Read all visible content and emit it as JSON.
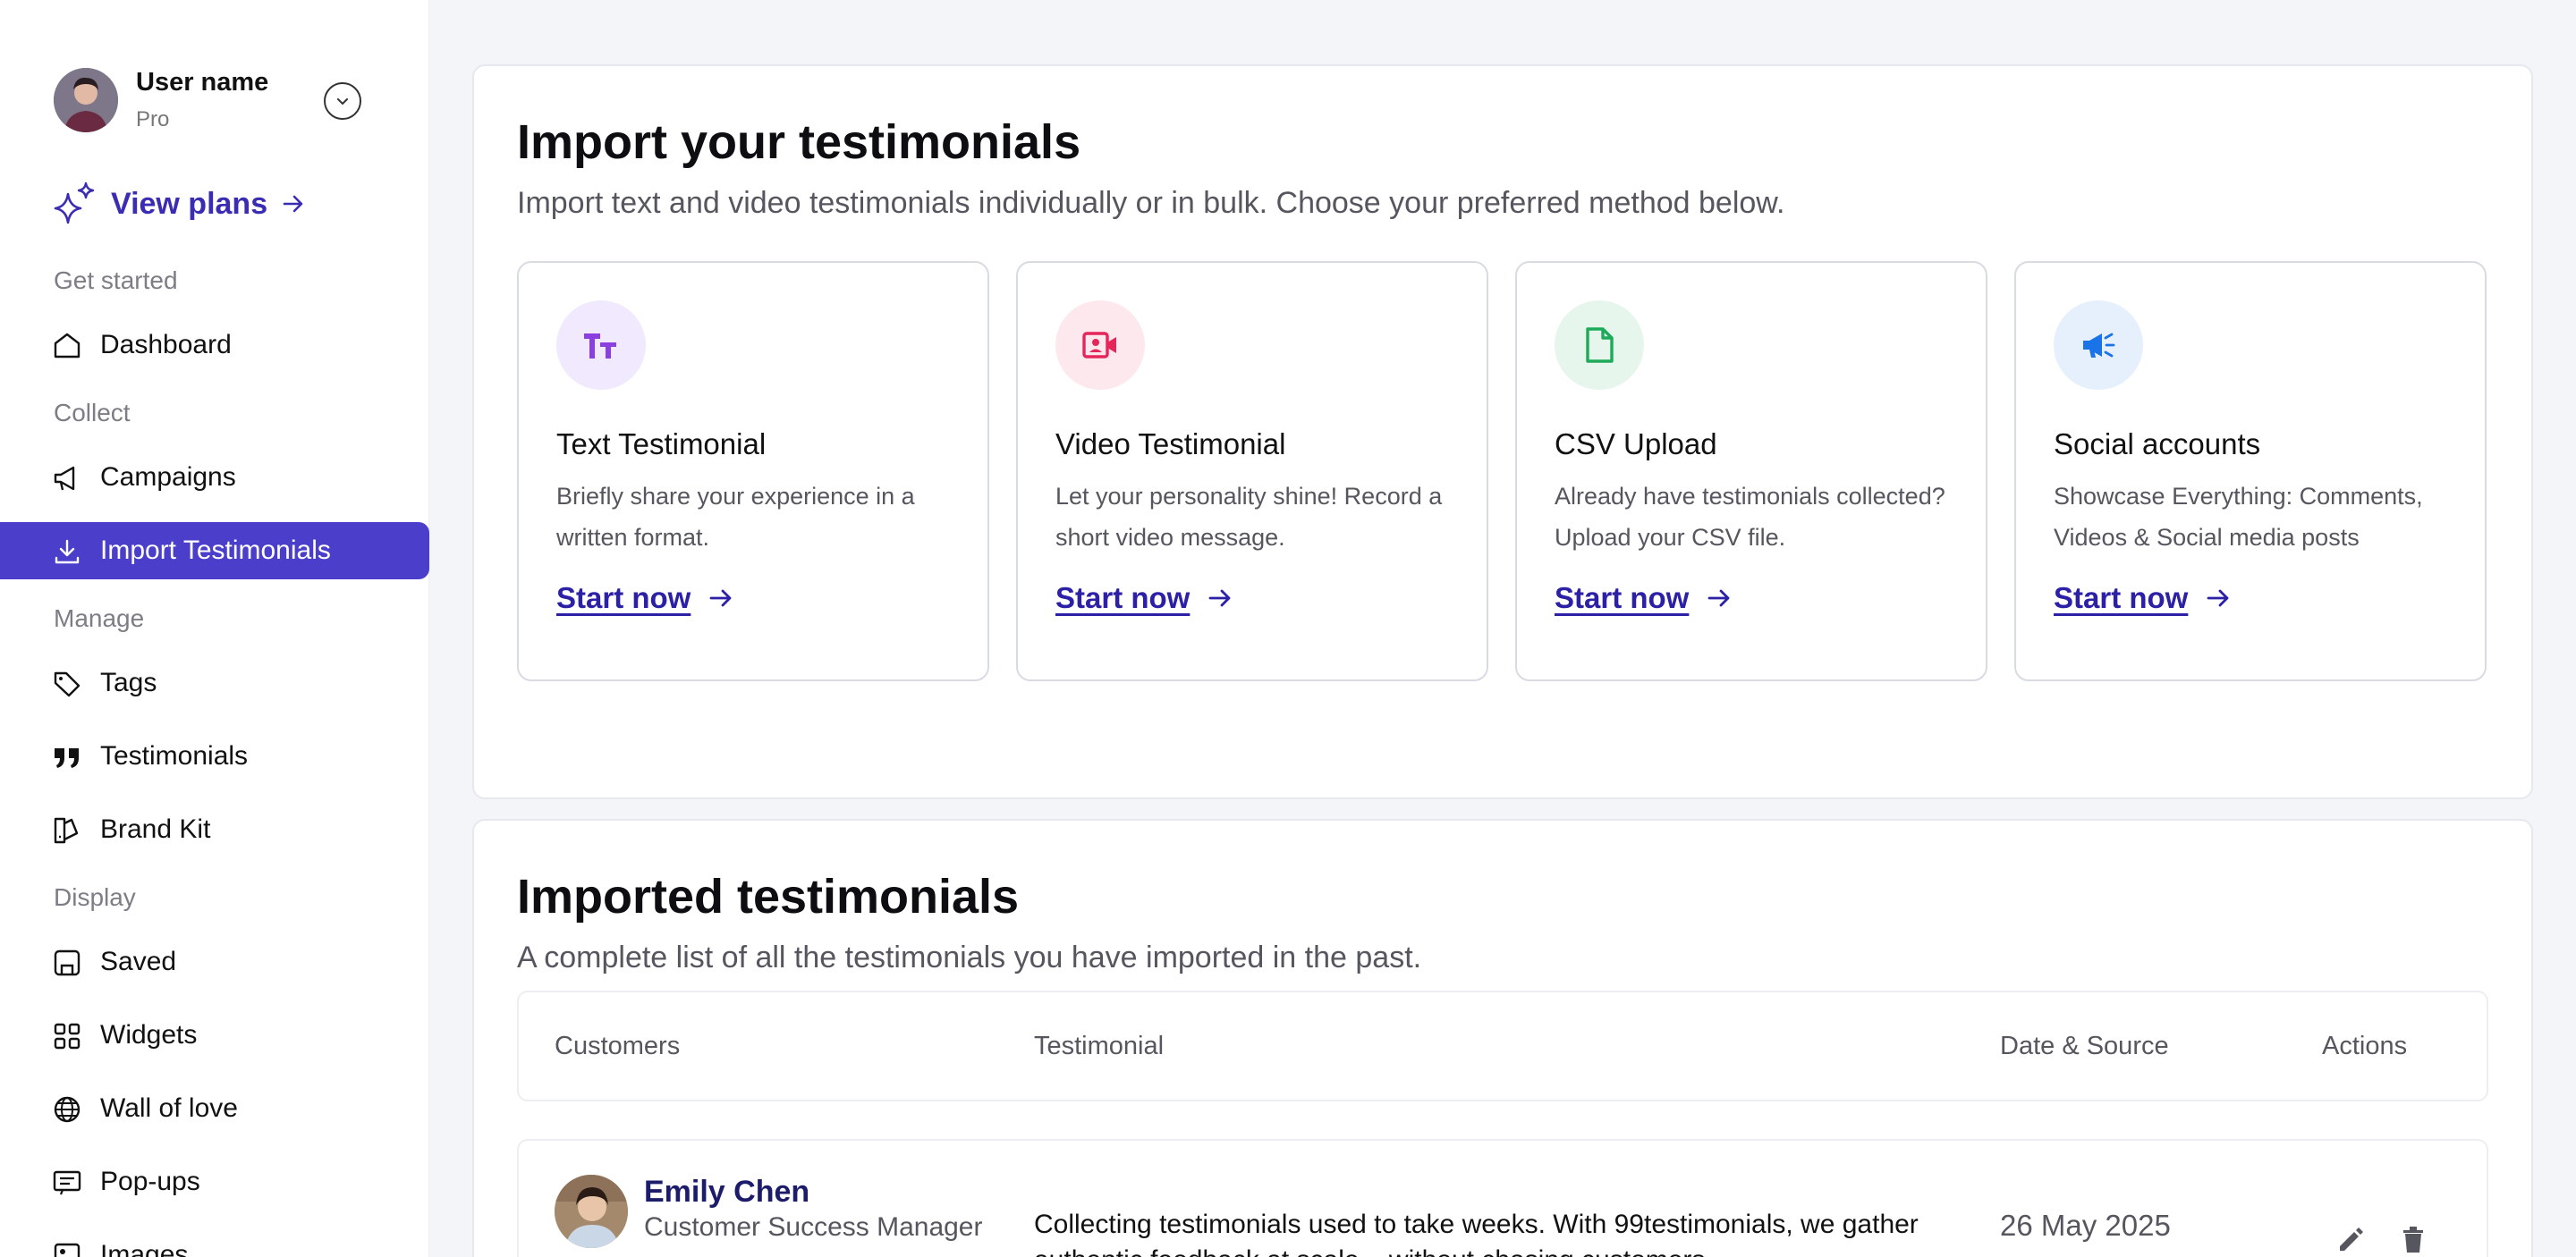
{
  "user": {
    "name": "User name",
    "plan": "Pro"
  },
  "view_plans": {
    "label": "View plans"
  },
  "sidebar": {
    "sections": {
      "get_started": "Get started",
      "collect": "Collect",
      "manage": "Manage",
      "display": "Display"
    },
    "items": {
      "dashboard": "Dashboard",
      "campaigns": "Campaigns",
      "import_testimonials": "Import Testimonials",
      "tags": "Tags",
      "testimonials": "Testimonials",
      "brand_kit": "Brand Kit",
      "saved": "Saved",
      "widgets": "Widgets",
      "wall_of_love": "Wall of love",
      "popups": "Pop-ups",
      "images": "Images"
    },
    "active_item": "import_testimonials"
  },
  "import": {
    "title": "Import your testimonials",
    "subtitle": "Import text and video testimonials individually or in bulk. Choose your preferred method below.",
    "cards": [
      {
        "icon": "text-size-icon",
        "title": "Text Testimonial",
        "description": "Briefly share your experience in a written format.",
        "cta": "Start now",
        "color": "#8b3fe0",
        "bg": "#f1e9fd"
      },
      {
        "icon": "video-contact-icon",
        "title": "Video Testimonial",
        "description": "Let your personality shine! Record a short video message.",
        "cta": "Start now",
        "color": "#e5265b",
        "bg": "#fde8ee"
      },
      {
        "icon": "file-icon",
        "title": "CSV Upload",
        "description": "Already have testimonials collected? Upload your CSV file.",
        "cta": "Start now",
        "color": "#1faa5a",
        "bg": "#e7f6ed"
      },
      {
        "icon": "megaphone-icon",
        "title": "Social accounts",
        "description": "Showcase Everything: Comments, Videos & Social media posts",
        "cta": "Start now",
        "color": "#1a73e8",
        "bg": "#e6f0fd"
      }
    ]
  },
  "imported": {
    "title": "Imported testimonials",
    "subtitle": "A complete list of all the testimonials you have imported in the past.",
    "columns": [
      "Customers",
      "Testimonial",
      "Date & Source",
      "Actions"
    ],
    "rows": [
      {
        "name": "Emily Chen",
        "role": "Customer Success Manager",
        "testimonial": "Collecting testimonials used to take weeks. With 99testimonials, we gather authentic feedback at scale – without chasing customers.",
        "date": "26 May 2025"
      }
    ]
  },
  "colors": {
    "accent": "#4a3ecb",
    "link": "#2b20a6",
    "background": "#f4f5f9"
  }
}
